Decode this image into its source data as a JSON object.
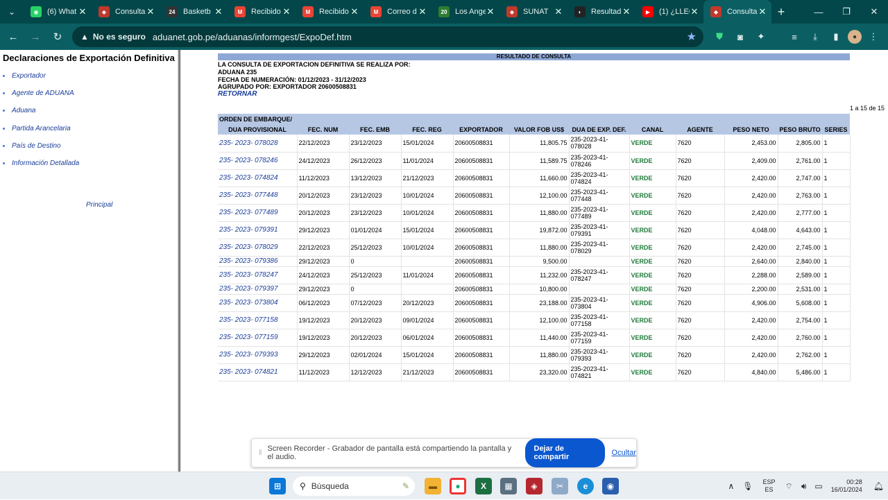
{
  "browser": {
    "tabs": [
      {
        "label": "(6) What",
        "favicon": "whatsapp-icon",
        "color": "#25d366",
        "glyph": "◉",
        "active": false
      },
      {
        "label": "Consulta",
        "favicon": "sunat-icon",
        "color": "#c0392b",
        "glyph": "◆",
        "active": false
      },
      {
        "label": "Basketb",
        "favicon": "basketball-icon",
        "color": "#333333",
        "glyph": "24",
        "active": false
      },
      {
        "label": "Recibido",
        "favicon": "gmail-icon",
        "color": "#ea4335",
        "glyph": "M",
        "active": false
      },
      {
        "label": "Recibido",
        "favicon": "gmail-icon",
        "color": "#ea4335",
        "glyph": "M",
        "active": false
      },
      {
        "label": "Correo d",
        "favicon": "gmail-icon",
        "color": "#ea4335",
        "glyph": "M",
        "active": false
      },
      {
        "label": "Los Ange",
        "favicon": "channel-icon",
        "color": "#2e7d32",
        "glyph": "20",
        "active": false
      },
      {
        "label": "SUNAT",
        "favicon": "sunat-icon",
        "color": "#c0392b",
        "glyph": "◆",
        "active": false
      },
      {
        "label": "Resultad",
        "favicon": "results-icon",
        "color": "#222222",
        "glyph": "◐",
        "active": false
      },
      {
        "label": "(1) ¿LLEG",
        "favicon": "youtube-icon",
        "color": "#ff0000",
        "glyph": "▶",
        "active": false
      },
      {
        "label": "Consulta",
        "favicon": "sunat-icon",
        "color": "#c0392b",
        "glyph": "◆",
        "active": true
      }
    ],
    "security_label": "No es seguro",
    "url": "aduanet.gob.pe/aduanas/informgest/ExpoDef.htm"
  },
  "sidebar": {
    "title": "Declaraciones de  Exportación Definitiva",
    "items": [
      "Exportador",
      "Agente de ADUANA",
      "Aduana",
      "Partida Arancelaria",
      "País de Destino",
      "Información Detallada"
    ],
    "principal": "Principal"
  },
  "content": {
    "header": "RESULTADO DE CONSULTA",
    "line1": "LA CONSULTA DE EXPORTACION DEFINITIVA SE REALIZA POR:",
    "line2": "ADUANA 235",
    "line3": "FECHA DE NUMERACIÓN: 01/12/2023 - 31/12/2023",
    "line4": "AGRUPADO POR: EXPORTADOR 20600508831",
    "retornar": "RETORNAR",
    "count": "1 a 15 de 15",
    "th_orden": "ORDEN DE EMBARQUE/",
    "columns": [
      "DUA PROVISIONAL",
      "FEC. NUM",
      "FEC. EMB",
      "FEC. REG",
      "EXPORTADOR",
      "VALOR FOB US$",
      "DUA DE EXP. DEF.",
      "CANAL",
      "AGENTE",
      "PESO NETO",
      "PESO BRUTO",
      "SERIES"
    ],
    "rows": [
      [
        "235- 2023- 078028",
        "22/12/2023",
        "23/12/2023",
        "15/01/2024",
        "20600508831",
        "11,805.75",
        "235-2023-41-078028",
        "VERDE",
        "7620",
        "2,453.00",
        "2,805.00",
        "1"
      ],
      [
        "235- 2023- 078246",
        "24/12/2023",
        "26/12/2023",
        "11/01/2024",
        "20600508831",
        "11,589.75",
        "235-2023-41-078246",
        "VERDE",
        "7620",
        "2,409.00",
        "2,761.00",
        "1"
      ],
      [
        "235- 2023- 074824",
        "11/12/2023",
        "13/12/2023",
        "21/12/2023",
        "20600508831",
        "11,660.00",
        "235-2023-41-074824",
        "VERDE",
        "7620",
        "2,420.00",
        "2,747.00",
        "1"
      ],
      [
        "235- 2023- 077448",
        "20/12/2023",
        "23/12/2023",
        "10/01/2024",
        "20600508831",
        "12,100.00",
        "235-2023-41-077448",
        "VERDE",
        "7620",
        "2,420.00",
        "2,763.00",
        "1"
      ],
      [
        "235- 2023- 077489",
        "20/12/2023",
        "23/12/2023",
        "10/01/2024",
        "20600508831",
        "11,880.00",
        "235-2023-41-077489",
        "VERDE",
        "7620",
        "2,420.00",
        "2,777.00",
        "1"
      ],
      [
        "235- 2023- 079391",
        "29/12/2023",
        "01/01/2024",
        "15/01/2024",
        "20600508831",
        "19,872.00",
        "235-2023-41-079391",
        "VERDE",
        "7620",
        "4,048.00",
        "4,643.00",
        "1"
      ],
      [
        "235- 2023- 078029",
        "22/12/2023",
        "25/12/2023",
        "10/01/2024",
        "20600508831",
        "11,880.00",
        "235-2023-41-078029",
        "VERDE",
        "7620",
        "2,420.00",
        "2,745.00",
        "1"
      ],
      [
        "235- 2023- 079386",
        "29/12/2023",
        "0",
        "",
        "20600508831",
        "9,500.00",
        "",
        "VERDE",
        "7620",
        "2,640.00",
        "2,840.00",
        "1"
      ],
      [
        "235- 2023- 078247",
        "24/12/2023",
        "25/12/2023",
        "11/01/2024",
        "20600508831",
        "11,232.00",
        "235-2023-41-078247",
        "VERDE",
        "7620",
        "2,288.00",
        "2,589.00",
        "1"
      ],
      [
        "235- 2023- 079397",
        "29/12/2023",
        "0",
        "",
        "20600508831",
        "10,800.00",
        "",
        "VERDE",
        "7620",
        "2,200.00",
        "2,531.00",
        "1"
      ],
      [
        "235- 2023- 073804",
        "06/12/2023",
        "07/12/2023",
        "20/12/2023",
        "20600508831",
        "23,188.00",
        "235-2023-41-073804",
        "VERDE",
        "7620",
        "4,906.00",
        "5,608.00",
        "1"
      ],
      [
        "235- 2023- 077158",
        "19/12/2023",
        "20/12/2023",
        "09/01/2024",
        "20600508831",
        "12,100.00",
        "235-2023-41-077158",
        "VERDE",
        "7620",
        "2,420.00",
        "2,754.00",
        "1"
      ],
      [
        "235- 2023- 077159",
        "19/12/2023",
        "20/12/2023",
        "06/01/2024",
        "20600508831",
        "11,440.00",
        "235-2023-41-077159",
        "VERDE",
        "7620",
        "2,420.00",
        "2,760.00",
        "1"
      ],
      [
        "235- 2023- 079393",
        "29/12/2023",
        "02/01/2024",
        "15/01/2024",
        "20600508831",
        "11,880.00",
        "235-2023-41-079393",
        "VERDE",
        "7620",
        "2,420.00",
        "2,762.00",
        "1"
      ],
      [
        "235- 2023- 074821",
        "11/12/2023",
        "12/12/2023",
        "21/12/2023",
        "20600508831",
        "23,320.00",
        "235-2023-41-074821",
        "VERDE",
        "7620",
        "4,840.00",
        "5,486.00",
        "1"
      ]
    ]
  },
  "share_bar": {
    "text": "Screen Recorder - Grabador de pantalla está compartiendo la pantalla y el audio.",
    "stop_label": "Dejar de compartir",
    "hide_label": "Ocultar"
  },
  "taskbar": {
    "search_placeholder": "Búsqueda",
    "lang_top": "ESP",
    "lang_bottom": "ES",
    "time": "00:28",
    "date": "16/01/2024"
  }
}
